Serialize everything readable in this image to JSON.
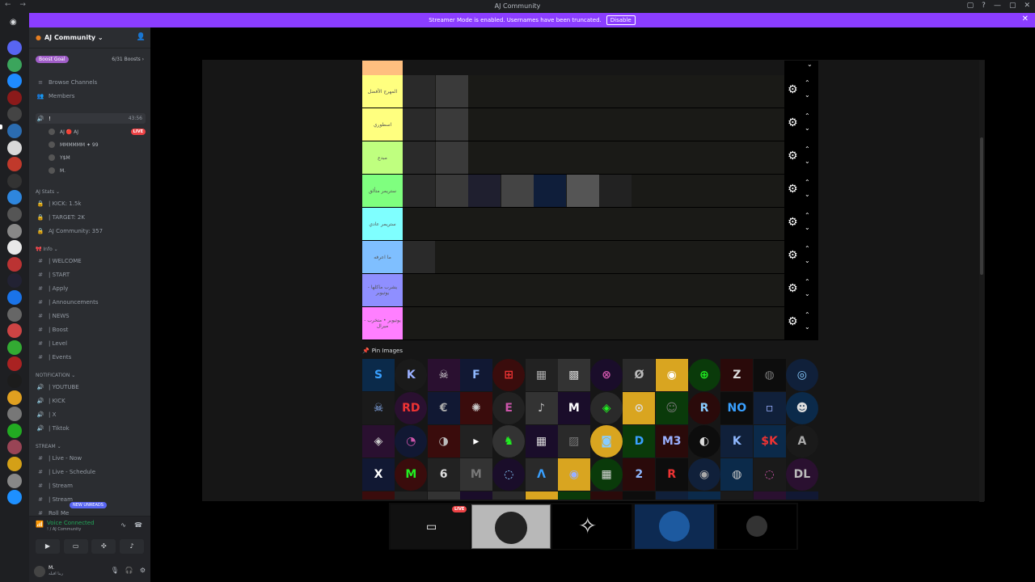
{
  "window": {
    "title": "AJ Community",
    "nav": "← →",
    "controls": [
      "▢",
      "?",
      "—",
      "▢",
      "✕"
    ]
  },
  "banner": {
    "message": "Streamer Mode is enabled. Usernames have been truncated.",
    "disable_label": "Disable",
    "close": "✕"
  },
  "server": {
    "name": "AJ Community ⌄",
    "boost_goal": "Boost Goal",
    "boost_count": "6/31 Boosts ›",
    "browse_channels": "Browse Channels",
    "members": "Members"
  },
  "voice_channel": {
    "name": "!",
    "time": "43:56",
    "users": [
      {
        "name": "AJ 🔴 AJ",
        "live": "LIVE"
      },
      {
        "name": "MMMMMM ✦ 99",
        "live": ""
      },
      {
        "name": "Y$M",
        "live": ""
      },
      {
        "name": "M.",
        "live": ""
      }
    ]
  },
  "categories": {
    "stats": "AJ Stats ⌄",
    "info": "🎀 Info ⌄",
    "notification": "NOTIFICATION ⌄",
    "stream": "STREAM ⌄"
  },
  "stats_channels": [
    "| KICK: 1.5k",
    "| TARGET: 2K",
    "AJ Community: 357"
  ],
  "info_channels": [
    "| WELCOME",
    "| START",
    "| Apply",
    "| Announcements",
    "| NEWS",
    "| Boost",
    "| Level",
    "| Events"
  ],
  "notification_channels": [
    "| YOUTUBE",
    "| KICK",
    "| X",
    "| Tiktok"
  ],
  "stream_channels": [
    "| Live - Now",
    "| Live - Schedule",
    "| Stream",
    "| Stream",
    "Roll Me"
  ],
  "new_unreads": "NEW UNREADS",
  "voice_panel": {
    "status": "Voice Connected",
    "sub": "! / AJ Community"
  },
  "user_panel": {
    "name": "M.",
    "status": "ربنا اقبله"
  },
  "tier_list": {
    "rows": [
      {
        "label": "المهرج الأفضل",
        "color": "#ffff7f",
        "items": 2
      },
      {
        "label": "اسطوري",
        "color": "#ffff7f",
        "items": 2
      },
      {
        "label": "مبدع",
        "color": "#bfff7f",
        "items": 2
      },
      {
        "label": "ستريمر متألق",
        "color": "#7fff7f",
        "items": 7
      },
      {
        "label": "ستريمر عادي",
        "color": "#7fffff",
        "items": 0
      },
      {
        "label": "ما اعرفه",
        "color": "#7fbfff",
        "items": 1
      },
      {
        "label": "يشرب ماكلها - يوتيوبر",
        "color": "#8f8fff",
        "items": 0
      },
      {
        "label": "يوتيوبر • متخرب - ميرال",
        "color": "#ff7fff",
        "items": 0
      }
    ],
    "gear": "⚙",
    "up": "⌃",
    "down": "⌄"
  },
  "pin_images": {
    "heading": "Pin Images",
    "glyphs": [
      [
        "S",
        "K",
        "☠",
        "F",
        "⊞",
        "▦",
        "▩",
        "⊗",
        "Ø",
        "◉",
        "⊕",
        "Z",
        "◍",
        "◎"
      ],
      [
        "☠",
        "RD",
        "€",
        "✺",
        "E",
        "♪",
        "M",
        "◈",
        "⊙",
        "☺",
        "R",
        "NO",
        "▫",
        "☻"
      ],
      [
        "◈",
        "◔",
        "◑",
        "▸",
        "♞",
        "▦",
        "▨",
        "◙",
        "D",
        "M3",
        "◐",
        "K",
        "$K",
        "A"
      ],
      [
        "X",
        "M",
        "6",
        "M",
        "◌",
        "ᐱ",
        "◉",
        "▦",
        "2",
        "R",
        "◉",
        "◍",
        "◌",
        "DL"
      ]
    ]
  },
  "stream_tiles": {
    "live": "LIVE"
  }
}
